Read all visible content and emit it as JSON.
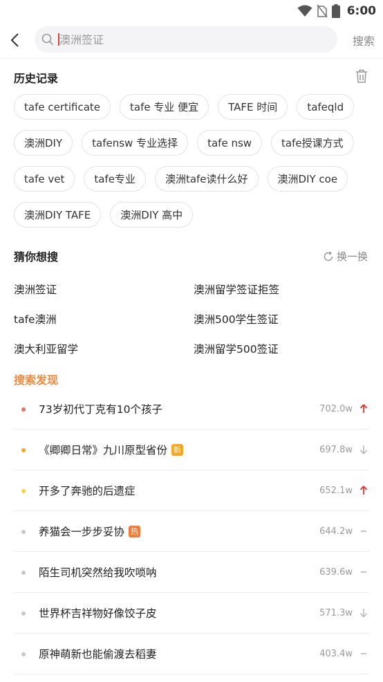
{
  "status_bar": {
    "time": "6:00",
    "icons": [
      "wifi-icon",
      "no-sim-icon",
      "battery-icon"
    ]
  },
  "search": {
    "query": "澳洲签证",
    "submit_label": "搜索"
  },
  "history": {
    "title": "历史记录",
    "rows": [
      [
        "tafe certificate",
        "tafe 专业 便宜",
        "TAFE 时间",
        "tafeqld"
      ],
      [
        "澳洲DIY",
        "tafensw 专业选择",
        "tafe nsw",
        "tafe授课方式"
      ],
      [
        "tafe vet",
        "tafe专业",
        "澳洲tafe读什么好",
        "澳洲DIY coe"
      ],
      [
        "澳洲DIY TAFE",
        "澳洲DIY 高中"
      ]
    ]
  },
  "guess": {
    "title": "猜你想搜",
    "refresh_label": "换一换",
    "items": [
      [
        "澳洲签证",
        "澳洲留学签证拒签"
      ],
      [
        "tafe澳洲",
        "澳洲500学生签证"
      ],
      [
        "澳大利亚留学",
        "澳洲留学500签证"
      ]
    ]
  },
  "discover": {
    "title": "搜索发现",
    "items": [
      {
        "text": "73岁初代丁克有10个孩子",
        "count": "702.0w",
        "trend": "up",
        "dot_color": "#f07060",
        "badge": ""
      },
      {
        "text": "《卿卿日常》九川原型省份",
        "count": "697.8w",
        "trend": "down",
        "dot_color": "#f5a623",
        "badge": "新"
      },
      {
        "text": "开多了奔驰的后遗症",
        "count": "652.1w",
        "trend": "up",
        "dot_color": "#f8d23c",
        "badge": ""
      },
      {
        "text": "养猫会一步步妥协",
        "count": "644.2w",
        "trend": "flat",
        "dot_color": "#c8c8c8",
        "badge": "热"
      },
      {
        "text": "陌生司机突然给我吹唢呐",
        "count": "639.6w",
        "trend": "flat",
        "dot_color": "#c8c8c8",
        "badge": ""
      },
      {
        "text": "世界杯吉祥物好像饺子皮",
        "count": "571.3w",
        "trend": "down",
        "dot_color": "#c8c8c8",
        "badge": ""
      },
      {
        "text": "原神萌新也能偷渡去稻妻",
        "count": "403.4w",
        "trend": "flat",
        "dot_color": "#c8c8c8",
        "badge": ""
      }
    ]
  },
  "colors": {
    "accent": "#f2893f",
    "up": "#e8332c",
    "down": "#b8b8b8",
    "badge_new": "#f5a623",
    "badge_hot": "#f07b3a"
  }
}
